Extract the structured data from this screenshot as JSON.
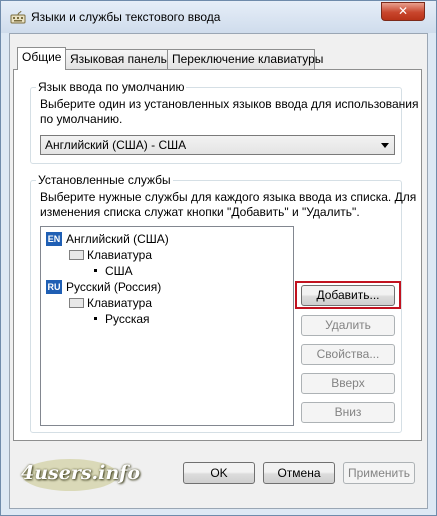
{
  "window": {
    "title": "Языки и службы текстового ввода",
    "close_symbol": "✕"
  },
  "tabs": [
    {
      "label": "Общие",
      "active": true
    },
    {
      "label": "Языковая панель",
      "active": false
    },
    {
      "label": "Переключение клавиатуры",
      "active": false
    }
  ],
  "default_input": {
    "group_title": "Язык ввода по умолчанию",
    "description_line1": "Выберите один из установленных языков ввода для использования",
    "description_line2": "по умолчанию.",
    "selected": "Английский (США) - США"
  },
  "installed": {
    "group_title": "Установленные службы",
    "description_line1": "Выберите нужные службы для каждого языка ввода из списка. Для",
    "description_line2": "изменения списка служат кнопки \"Добавить\" и \"Удалить\".",
    "tree": [
      {
        "badge": "EN",
        "language": "Английский (США)",
        "category": "Клавиатура",
        "item": "США"
      },
      {
        "badge": "RU",
        "language": "Русский (Россия)",
        "category": "Клавиатура",
        "item": "Русская"
      }
    ],
    "buttons": {
      "add": "Добавить...",
      "remove": "Удалить",
      "properties": "Свойства...",
      "up": "Вверх",
      "down": "Вниз"
    }
  },
  "footer": {
    "ok": "OK",
    "cancel": "Отмена",
    "apply": "Применить"
  },
  "watermark": "4users.info",
  "colors": {
    "highlight": "#c1121f",
    "language_badge": "#1f5fb4"
  }
}
